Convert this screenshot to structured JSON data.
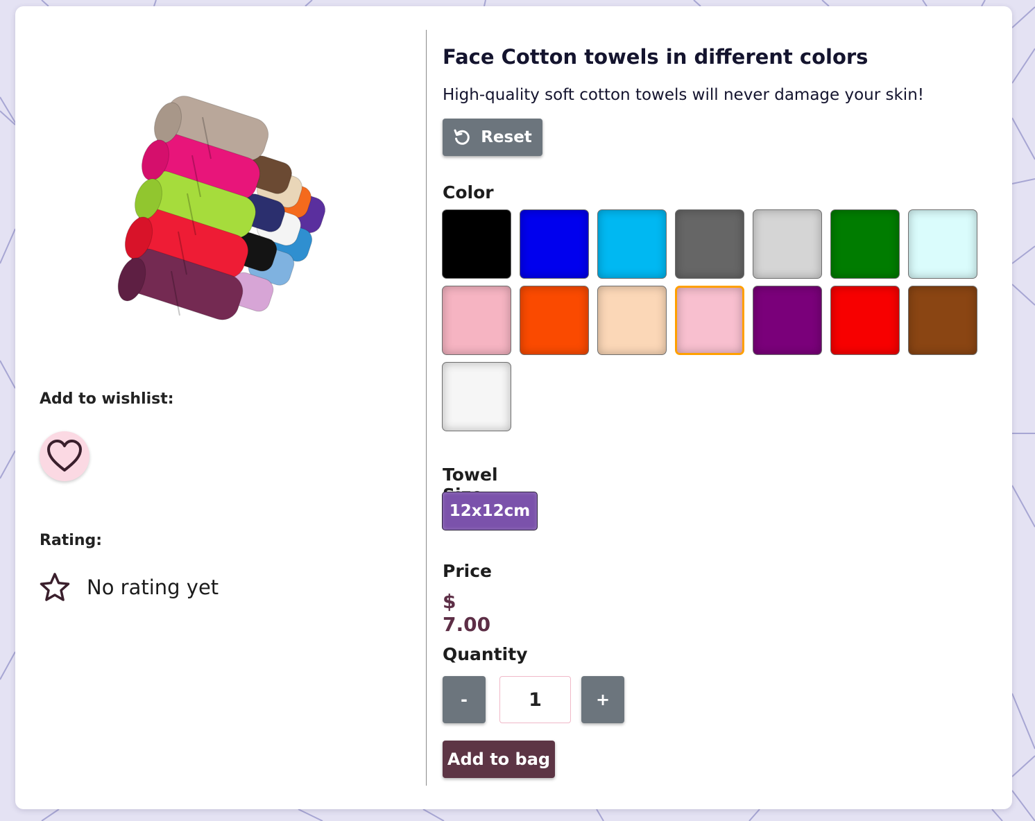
{
  "product": {
    "title": "Face Cotton towels in different colors",
    "description": "High-quality soft cotton towels will never damage your skin!",
    "image_alt": "Stack of rolled colorful cotton towels"
  },
  "reset": {
    "label": "Reset",
    "icon": "undo-icon"
  },
  "wishlist": {
    "label": "Add to wishlist:",
    "icon": "heart-icon"
  },
  "rating": {
    "label": "Rating:",
    "text": "No rating yet",
    "icon": "star-outline-icon"
  },
  "color": {
    "label": "Color",
    "options": [
      {
        "name": "black",
        "hex": "#000000"
      },
      {
        "name": "blue",
        "hex": "#0000ee"
      },
      {
        "name": "deep-sky-blue",
        "hex": "#00b8f2"
      },
      {
        "name": "dim-gray",
        "hex": "#666666"
      },
      {
        "name": "light-gray",
        "hex": "#d5d5d5"
      },
      {
        "name": "green",
        "hex": "#007c00"
      },
      {
        "name": "light-cyan",
        "hex": "#dafcfc"
      },
      {
        "name": "pink",
        "hex": "#f6b4c2"
      },
      {
        "name": "orange-red",
        "hex": "#fa4a00"
      },
      {
        "name": "peach-puff",
        "hex": "#fbd7b7"
      },
      {
        "name": "light-pink",
        "hex": "#f8bfcf"
      },
      {
        "name": "purple",
        "hex": "#7a007a"
      },
      {
        "name": "red",
        "hex": "#f70000"
      },
      {
        "name": "saddle-brown",
        "hex": "#8a4513"
      },
      {
        "name": "white",
        "hex": "#f6f6f6"
      }
    ],
    "selected_index": 10,
    "selected_border": "#ffa000"
  },
  "size": {
    "label": "Towel Size",
    "options": [
      "12x12cm"
    ],
    "selected": "12x12cm"
  },
  "price": {
    "label": "Price",
    "value": "$ 7.00"
  },
  "quantity": {
    "label": "Quantity",
    "value": "1",
    "minus": "-",
    "plus": "+"
  },
  "bag": {
    "label": "Add to bag"
  },
  "colors": {
    "background": "#e4e2f3",
    "card": "#ffffff",
    "secondary_button": "#6c757d",
    "size_button": "#7b52ab",
    "bag_button": "#5d3545",
    "price_text": "#5d2e46",
    "wishlist_bg": "#fbd9e3"
  }
}
